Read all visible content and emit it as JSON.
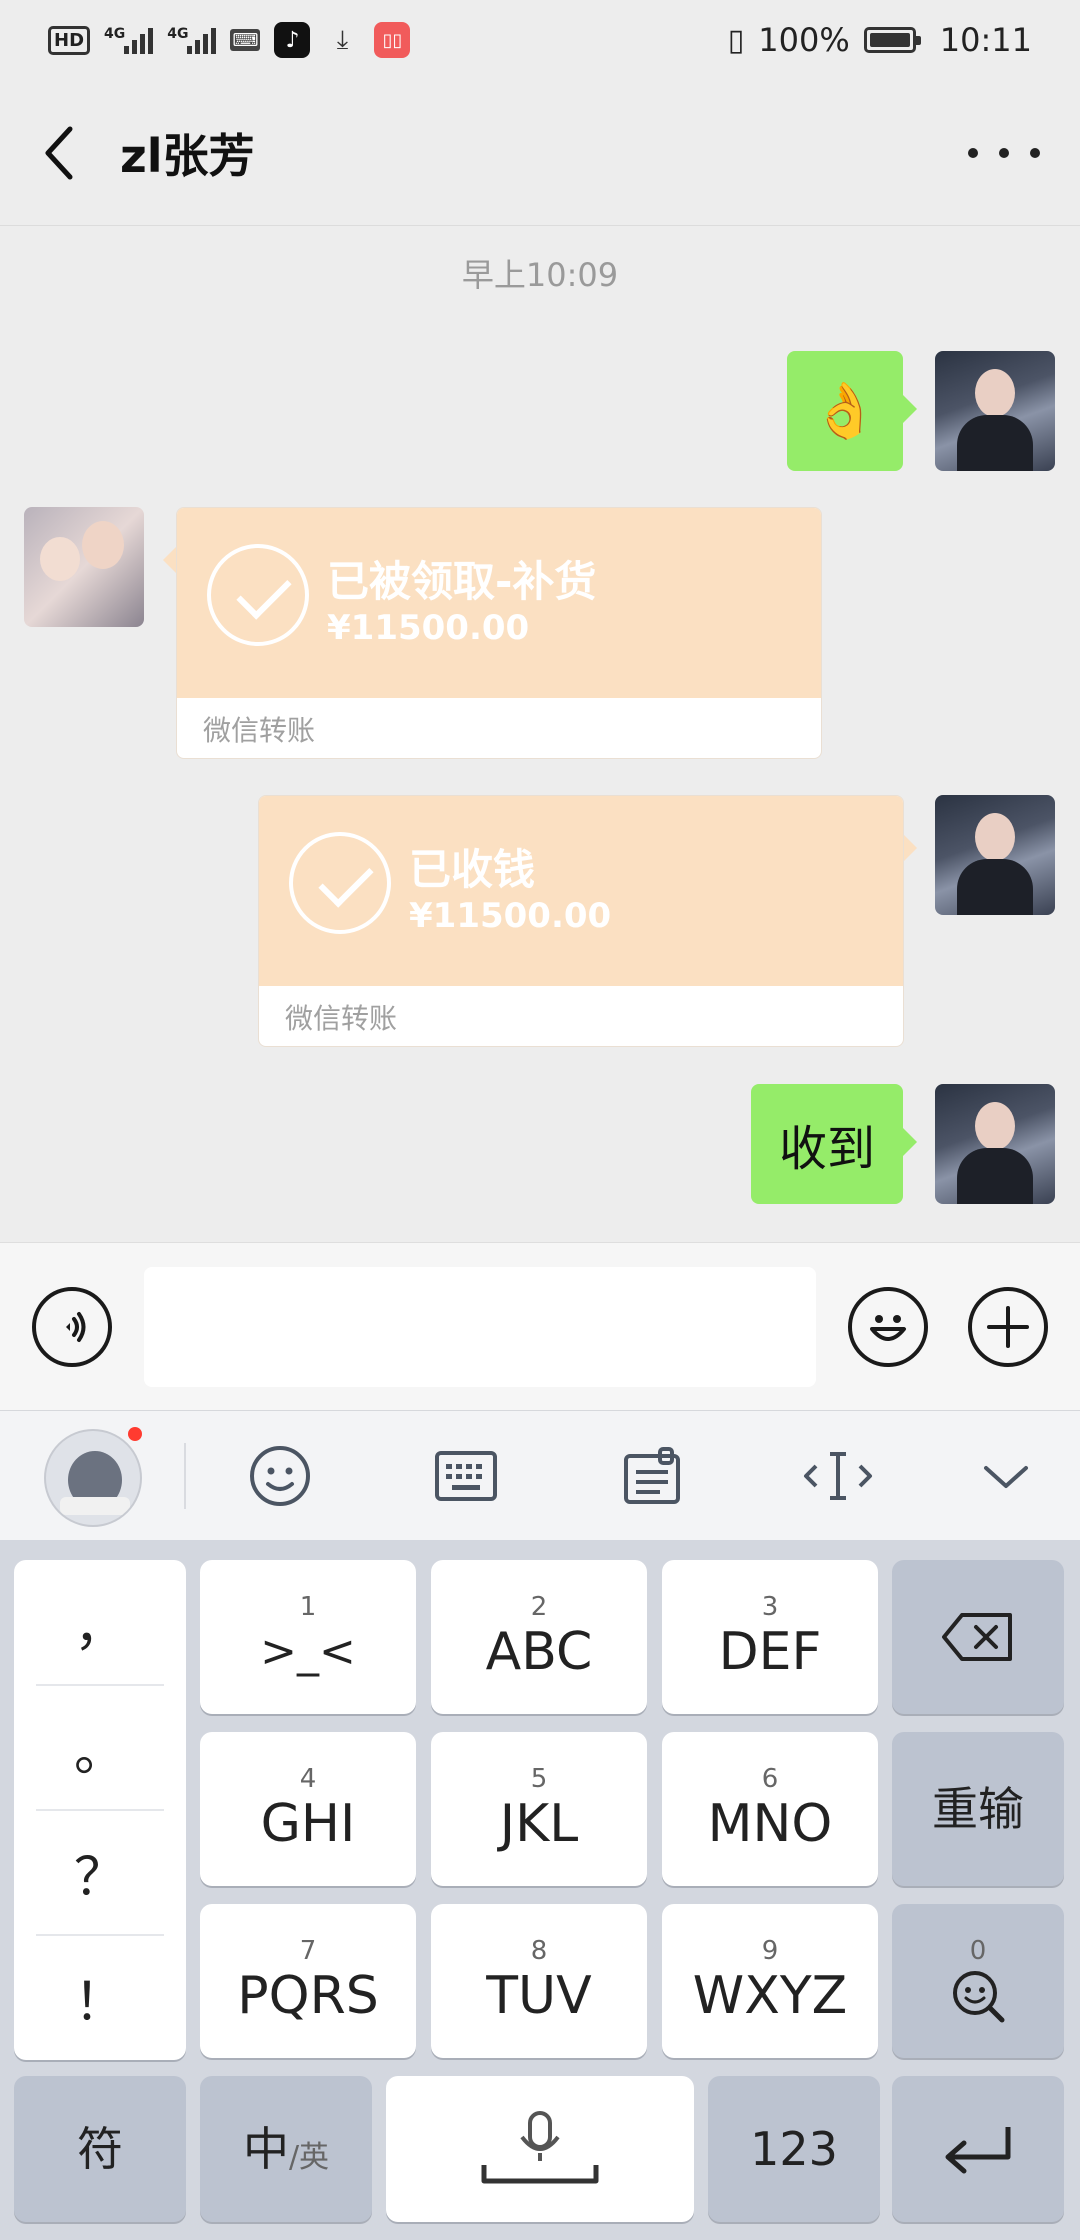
{
  "status_bar": {
    "hd_label": "HD",
    "sim1_label": "4G",
    "sim2_label": "4G",
    "battery_percent": "100%",
    "time": "10:11"
  },
  "header": {
    "title": "zl张芳"
  },
  "chat": {
    "timestamp": "早上10:09",
    "messages": [
      {
        "sender": "me",
        "type": "emoji",
        "content": "👌"
      },
      {
        "sender": "other",
        "type": "transfer",
        "title": "已被领取-补货",
        "amount": "¥11500.00",
        "footer": "微信转账"
      },
      {
        "sender": "me",
        "type": "transfer",
        "title": "已收钱",
        "amount": "¥11500.00",
        "footer": "微信转账"
      },
      {
        "sender": "me",
        "type": "text",
        "content": "收到"
      }
    ]
  },
  "input_bar": {
    "voice_icon": "voice-icon",
    "emoji_icon": "emoji-icon",
    "plus_icon": "plus-icon",
    "placeholder": ""
  },
  "keyboard_toolbar": {
    "icons": [
      "mascot-icon",
      "emoji-face-icon",
      "keyboard-icon",
      "clipboard-icon",
      "cursor-icon",
      "chevron-down-icon"
    ]
  },
  "keyboard": {
    "punctuation": [
      "，",
      "。",
      "？",
      "！"
    ],
    "rows": [
      [
        {
          "num": "1",
          "label": ">_<"
        },
        {
          "num": "2",
          "label": "ABC"
        },
        {
          "num": "3",
          "label": "DEF"
        }
      ],
      [
        {
          "num": "4",
          "label": "GHI"
        },
        {
          "num": "5",
          "label": "JKL"
        },
        {
          "num": "6",
          "label": "MNO"
        }
      ],
      [
        {
          "num": "7",
          "label": "PQRS"
        },
        {
          "num": "8",
          "label": "TUV"
        },
        {
          "num": "9",
          "label": "WXYZ"
        }
      ]
    ],
    "reenter_label": "重输",
    "zero_label": "0",
    "symbol_label": "符",
    "lang_main": "中",
    "lang_sub": "/英",
    "num_label": "123"
  },
  "colors": {
    "bubble_green": "#95ec69",
    "transfer_orange": "#fbe0c2",
    "background": "#ededed"
  }
}
